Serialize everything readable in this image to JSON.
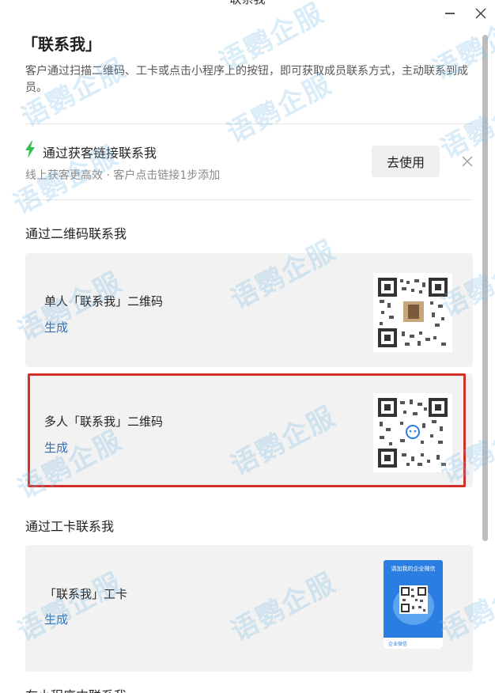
{
  "window": {
    "title": "联系我"
  },
  "header": {
    "title": "「联系我」",
    "description": "客户通过扫描二维码、工卡或点击小程序上的按钮，即可获取成员联系方式，主动联系到成员。"
  },
  "link_option": {
    "icon": "lightning-icon",
    "title": "通过获客链接联系我",
    "subtitle": "线上获客更高效 · 客户点击链接1步添加",
    "button_label": "去使用",
    "accent_color": "#36c252"
  },
  "qr_section": {
    "title": "通过二维码联系我",
    "items": [
      {
        "title": "单人「联系我」二维码",
        "action": "生成"
      },
      {
        "title": "多人「联系我」二维码",
        "action": "生成"
      }
    ]
  },
  "badge_section": {
    "title": "通过工卡联系我",
    "item": {
      "title": "「联系我」工卡",
      "action": "生成"
    },
    "badge_header": "请加我的企业微信",
    "badge_footer": "企业微信"
  },
  "miniprogram_section": {
    "title": "在小程序中联系我"
  },
  "watermark": "语鹦企服",
  "colors": {
    "link": "#2e6fb8",
    "highlight": "#d2302a",
    "card_bg": "#f2f2f2"
  }
}
